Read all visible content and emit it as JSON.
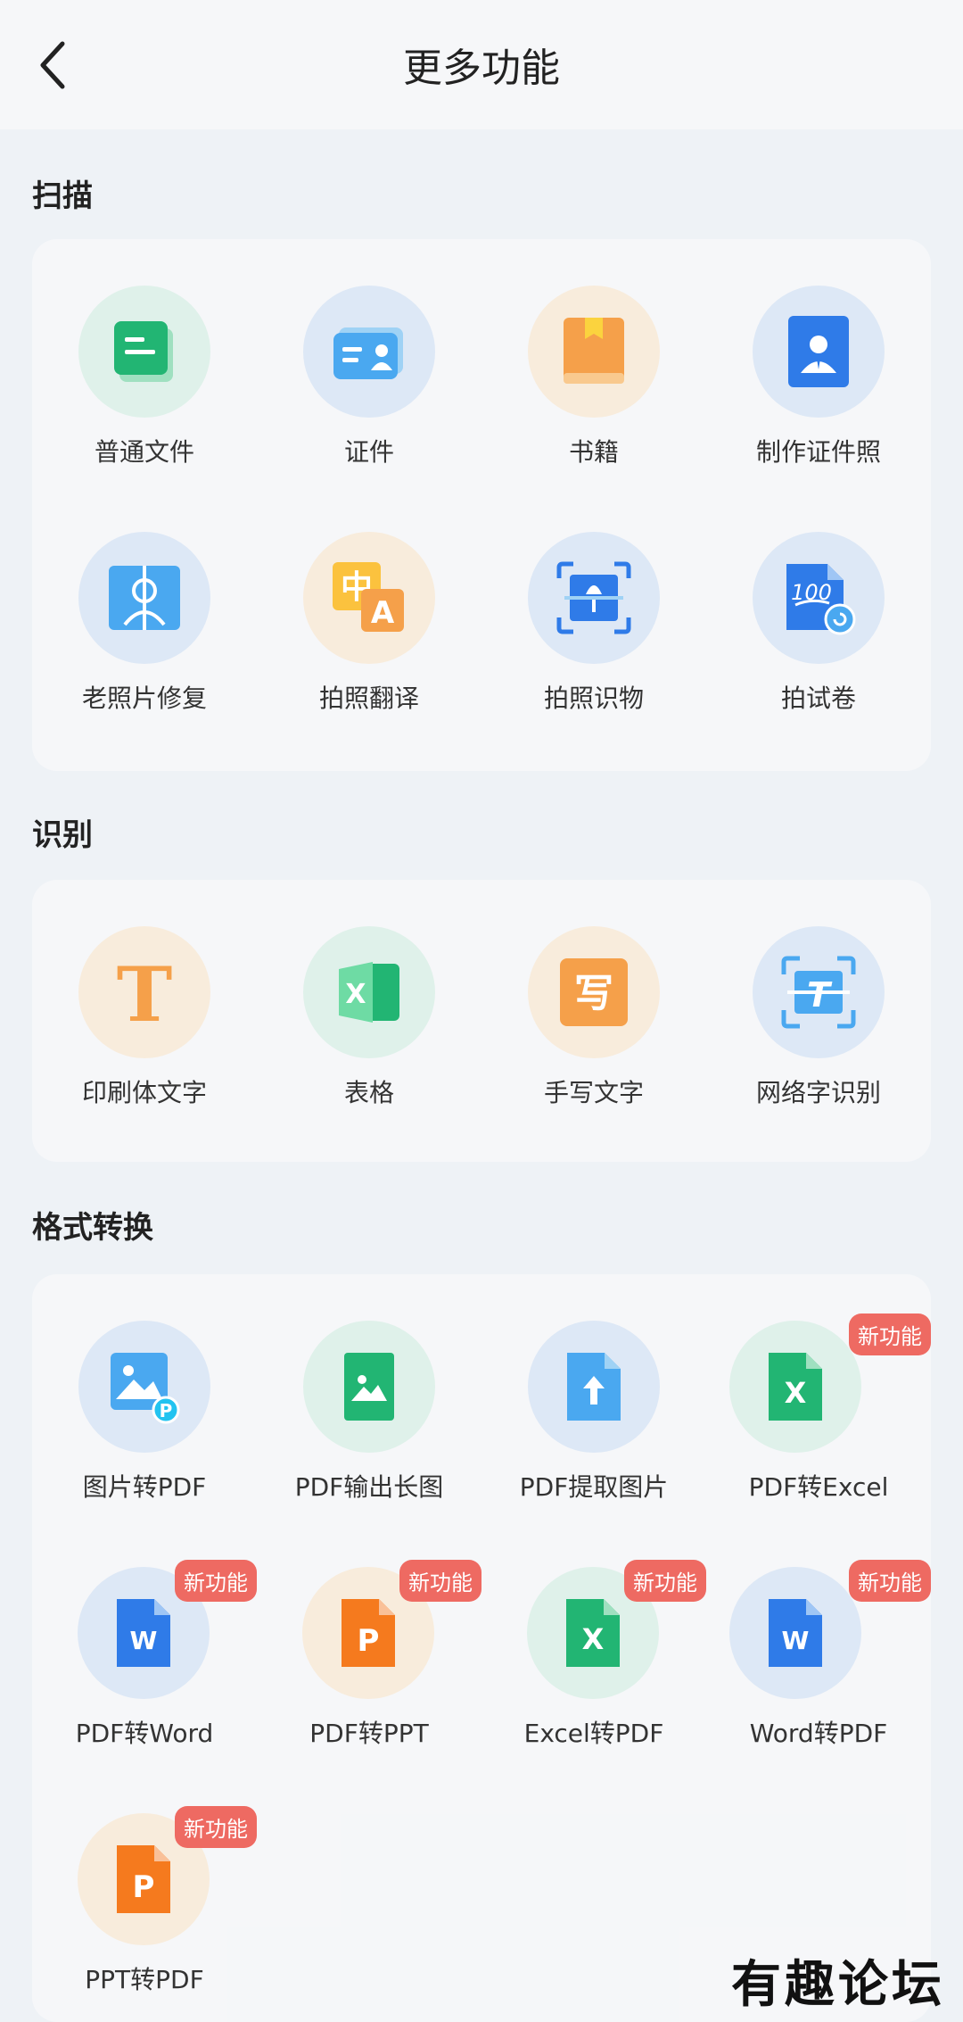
{
  "header": {
    "title": "更多功能"
  },
  "sections": [
    {
      "title": "扫描",
      "items": [
        {
          "label": "普通文件",
          "icon": "document-icon"
        },
        {
          "label": "证件",
          "icon": "id-card-icon"
        },
        {
          "label": "书籍",
          "icon": "book-icon"
        },
        {
          "label": "制作证件照",
          "icon": "id-photo-icon"
        },
        {
          "label": "老照片修复",
          "icon": "photo-restore-icon"
        },
        {
          "label": "拍照翻译",
          "icon": "translate-icon"
        },
        {
          "label": "拍照识物",
          "icon": "object-scan-icon"
        },
        {
          "label": "拍试卷",
          "icon": "exam-paper-icon"
        }
      ]
    },
    {
      "title": "识别",
      "items": [
        {
          "label": "印刷体文字",
          "icon": "print-text-icon"
        },
        {
          "label": "表格",
          "icon": "excel-table-icon"
        },
        {
          "label": "手写文字",
          "icon": "handwriting-icon"
        },
        {
          "label": "网络字识别",
          "icon": "web-text-scan-icon"
        }
      ]
    },
    {
      "title": "格式转换",
      "items": [
        {
          "label": "图片转PDF",
          "icon": "image-to-pdf-icon"
        },
        {
          "label": "PDF输出长图",
          "icon": "pdf-long-image-icon"
        },
        {
          "label": "PDF提取图片",
          "icon": "pdf-extract-image-icon"
        },
        {
          "label": "PDF转Excel",
          "icon": "excel-file-icon",
          "badge": "新功能"
        },
        {
          "label": "PDF转Word",
          "icon": "word-file-icon",
          "badge": "新功能"
        },
        {
          "label": "PDF转PPT",
          "icon": "ppt-file-icon",
          "badge": "新功能"
        },
        {
          "label": "Excel转PDF",
          "icon": "excel-file-icon",
          "badge": "新功能"
        },
        {
          "label": "Word转PDF",
          "icon": "word-file-icon",
          "badge": "新功能"
        },
        {
          "label": "PPT转PDF",
          "icon": "ppt-file-icon",
          "badge": "新功能"
        }
      ]
    }
  ],
  "watermark": "有趣论坛",
  "colors": {
    "green": "#22b573",
    "blue": "#2f7be8",
    "lightblue": "#4aa8f0",
    "orange": "#f5a04a",
    "badge": "#ee6a62"
  }
}
